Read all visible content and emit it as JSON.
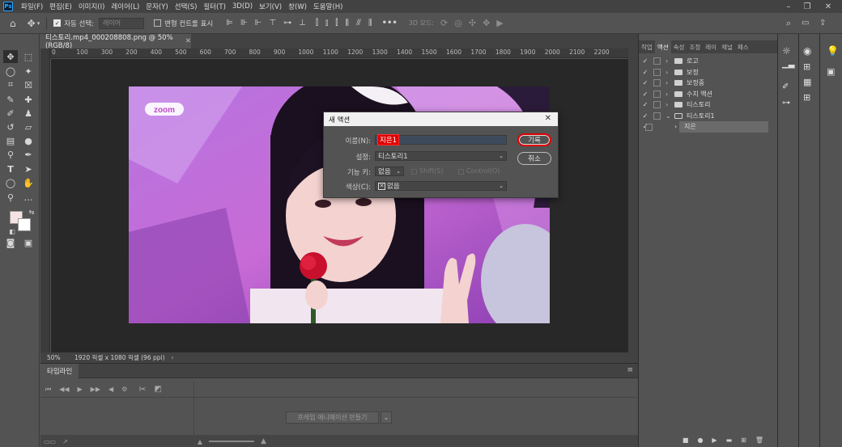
{
  "menu": {
    "logo": "Ps",
    "items": [
      "파일(F)",
      "편집(E)",
      "이미지(I)",
      "레이어(L)",
      "문자(Y)",
      "선택(S)",
      "필터(T)",
      "3D(D)",
      "보기(V)",
      "창(W)",
      "도움말(H)"
    ]
  },
  "options": {
    "auto_select_label": "자동 선택:",
    "auto_select_value": "레이어",
    "transform_label": "변형 컨트롤 표시",
    "more": "•••",
    "mode_3d": "3D 모드:"
  },
  "document": {
    "tab_title": "티스토리.mp4_000208808.png @ 50% (RGB/8)",
    "ruler_ticks": [
      "0",
      "100",
      "300",
      "200",
      "400",
      "500",
      "600",
      "700",
      "800",
      "900",
      "1000",
      "1100",
      "1200",
      "1300",
      "1400",
      "1500",
      "1600",
      "1700",
      "1800",
      "1900",
      "2000",
      "2100",
      "2200"
    ],
    "zoom": "50%",
    "dimensions": "1920 픽셀 x 1080 픽셀 (96 ppi)",
    "watermark": "zoom"
  },
  "timeline": {
    "tab_label": "타임라인",
    "create_button": "프레임 애니메이션 만들기"
  },
  "right_panel": {
    "tabs": [
      "작업",
      "액션",
      "속성",
      "조정",
      "레이",
      "채널",
      "패스"
    ],
    "active_tab": "액션",
    "actions": [
      {
        "label": "로고",
        "type": "folder"
      },
      {
        "label": "보정",
        "type": "folder"
      },
      {
        "label": "보정중",
        "type": "folder"
      },
      {
        "label": "수치 액션",
        "type": "folder"
      },
      {
        "label": "티스토리",
        "type": "folder"
      },
      {
        "label": "티스토리1",
        "type": "folder",
        "open": true
      },
      {
        "label": "지은",
        "type": "action",
        "selected": true
      }
    ]
  },
  "dialog": {
    "title": "새 액션",
    "name_label": "이름(N):",
    "name_value": "지은1",
    "set_label": "설정:",
    "set_value": "티스토리1",
    "fkey_label": "기능 키:",
    "fkey_value": "없음",
    "shift_label": "Shift(S)",
    "control_label": "Control(O)",
    "color_label": "색상(C):",
    "color_value": "없음",
    "record_button": "기록",
    "cancel_button": "취소"
  },
  "colors": {
    "highlight": "#e00000",
    "chrome_dark": "#424242",
    "chrome": "#535353",
    "canvas_bg": "#282828"
  }
}
